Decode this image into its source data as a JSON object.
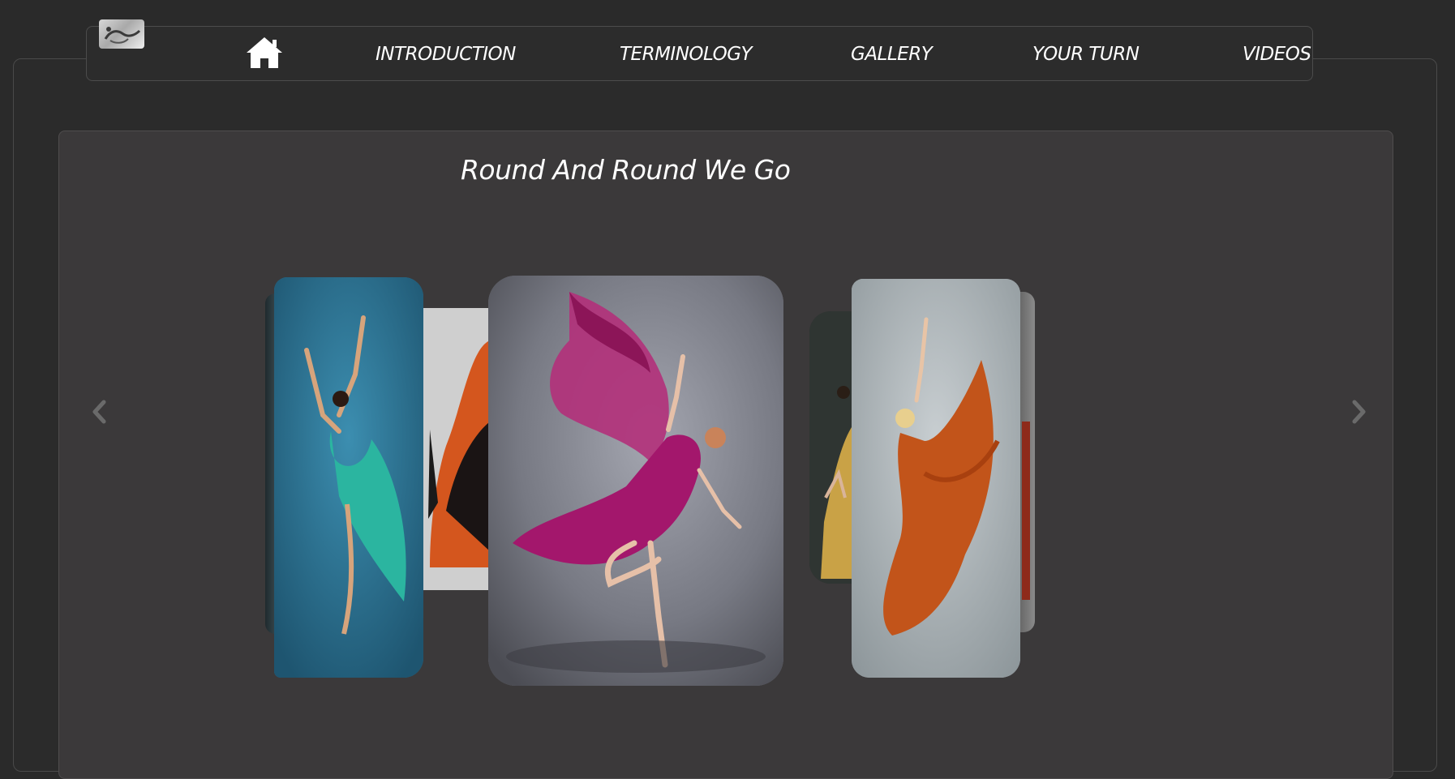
{
  "nav": {
    "logo_icon": "dancer-logo-icon",
    "home_icon": "home-icon",
    "links": [
      "INTRODUCTION",
      "TERMINOLOGY",
      "GALLERY",
      "YOUR TURN",
      "VIDEOS"
    ]
  },
  "gallery": {
    "title": "Round And Round We Go",
    "prev_icon": "chevron-left-icon",
    "next_icon": "chevron-right-icon",
    "slides": [
      {
        "name": "dancer-teal-dress",
        "accent": "#2bb5a0"
      },
      {
        "name": "dancer-orange-black",
        "accent": "#d4561e"
      },
      {
        "name": "dancer-magenta-dress",
        "accent": "#a3176c"
      },
      {
        "name": "dancer-gold-dress",
        "accent": "#c9a246"
      },
      {
        "name": "dancer-rust-dress",
        "accent": "#c2541a"
      }
    ]
  },
  "colors": {
    "background": "#2a2a2a",
    "panel": "#3b393a",
    "text": "#ffffff",
    "arrow": "#6a6a6a"
  }
}
